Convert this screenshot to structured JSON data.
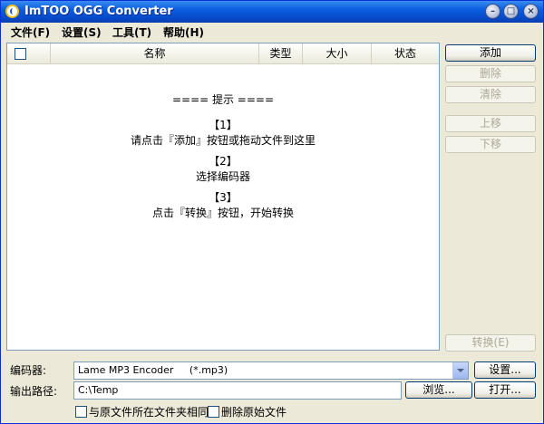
{
  "window": {
    "title": "ImTOO OGG Converter"
  },
  "menu": [
    {
      "label": "文件(F)"
    },
    {
      "label": "设置(S)"
    },
    {
      "label": "工具(T)"
    },
    {
      "label": "帮助(H)"
    }
  ],
  "list": {
    "columns": {
      "name": "名称",
      "type": "类型",
      "size": "大小",
      "status": "状态"
    },
    "hints": {
      "title": "==== 提示 ====",
      "step1_num": "【1】",
      "step1_text": "请点击『添加』按钮或拖动文件到这里",
      "step2_num": "【2】",
      "step2_text": "选择编码器",
      "step3_num": "【3】",
      "step3_text": "点击『转换』按钮，开始转换"
    }
  },
  "side_buttons": {
    "add": "添加",
    "delete": "删除",
    "clear": "清除",
    "up": "上移",
    "down": "下移",
    "convert": "转换(E)"
  },
  "bottom": {
    "encoder_label": "编码器:",
    "encoder_value": "Lame MP3 Encoder     (*.mp3)",
    "settings_button": "设置...",
    "output_label": "输出路径:",
    "output_value": "C:\\Temp",
    "browse_button": "浏览...",
    "open_button": "打开...",
    "same_folder_label": "与原文件所在文件夹相同",
    "delete_original_label": "删除原始文件"
  }
}
